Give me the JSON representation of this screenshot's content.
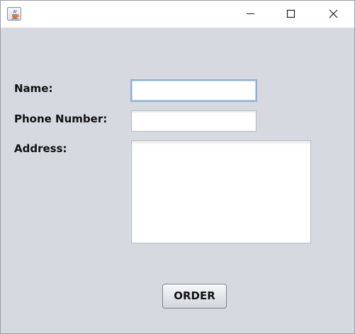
{
  "window": {
    "app_icon": "java-cup-icon",
    "controls": {
      "minimize_icon": "minimize-icon",
      "maximize_icon": "maximize-icon",
      "close_icon": "close-icon"
    }
  },
  "form": {
    "name_label": "Name:",
    "name_value": "",
    "phone_label": "Phone Number:",
    "phone_value": "",
    "address_label": "Address:",
    "address_value": "",
    "order_button": "ORDER"
  },
  "colors": {
    "window_background": "#d6d9e0",
    "focus_border": "#8fb0d3",
    "titlebar": "#ffffff"
  }
}
